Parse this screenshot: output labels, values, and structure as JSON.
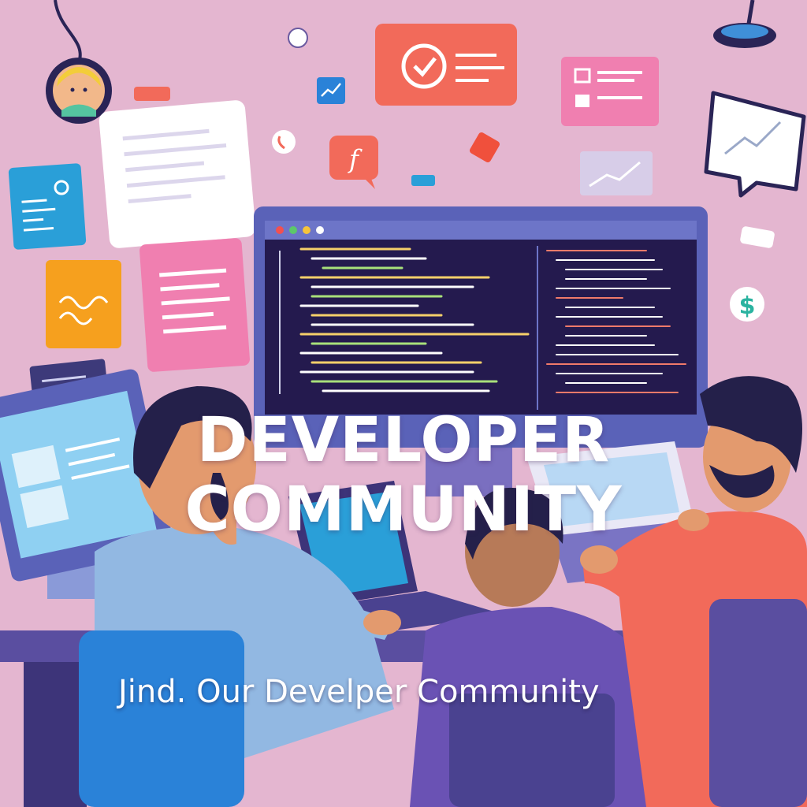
{
  "headline": {
    "line1": "DEVELOPER",
    "line2": "COMMUNITY"
  },
  "tagline": "Jind. Our Develper Community",
  "icons": {
    "dollar": "$",
    "flutter": "f"
  },
  "colors": {
    "background": "#e4b6d0",
    "monitor_frame": "#5a62b8",
    "screen": "#241a4e",
    "orange": "#f26a5a",
    "pink": "#f07fb0",
    "blue": "#2a9fd8",
    "amber": "#f6a01e"
  }
}
